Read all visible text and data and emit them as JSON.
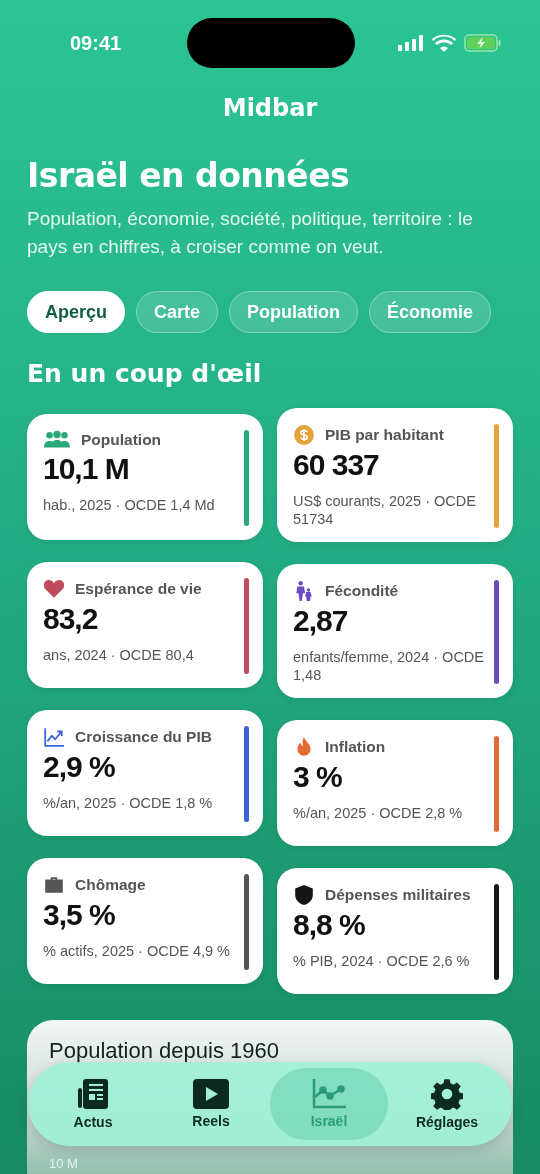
{
  "status_bar": {
    "time": "09:41"
  },
  "app_title": "Midbar",
  "header": {
    "title": "Israël en données",
    "subtitle": "Population, économie, société, politique, territoire : le pays en chiffres, à croiser comme on veut."
  },
  "tabs": [
    {
      "label": "Aperçu",
      "selected": true
    },
    {
      "label": "Carte",
      "selected": false
    },
    {
      "label": "Population",
      "selected": false
    },
    {
      "label": "Économie",
      "selected": false
    }
  ],
  "section_title": "En un coup d'œil",
  "cards": [
    {
      "label": "Population",
      "value": "10,1 M",
      "note": "hab., 2025 · OCDE 1,4 Md",
      "color": "#2aa97a"
    },
    {
      "label": "PIB par habitant",
      "value": "60 337",
      "note": "US$ courants, 2025 · OCDE 51734",
      "color": "#e3a33a"
    },
    {
      "label": "Espérance de vie",
      "value": "83,2",
      "note": "ans, 2024 · OCDE 80,4",
      "color": "#c04a5e"
    },
    {
      "label": "Fécondité",
      "value": "2,87",
      "note": "enfants/femme, 2024 · OCDE 1,48",
      "color": "#6a4bc0"
    },
    {
      "label": "Croissance du PIB",
      "value": "2,9 %",
      "note": "%/an, 2025 · OCDE 1,8 %",
      "color": "#3b63d6"
    },
    {
      "label": "Inflation",
      "value": "3 %",
      "note": "%/an, 2025 · OCDE 2,8 %",
      "color": "#e26a35"
    },
    {
      "label": "Chômage",
      "value": "3,5 %",
      "note": "% actifs, 2025 · OCDE 4,9 %",
      "color": "#555555"
    },
    {
      "label": "Dépenses militaires",
      "value": "8,8 %",
      "note": "% PIB, 2024 · OCDE 2,6 %",
      "color": "#151515"
    }
  ],
  "chart_card": {
    "title": "Population depuis 1960",
    "tick_label": "10 M"
  },
  "tab_bar": [
    {
      "label": "Actus",
      "selected": false
    },
    {
      "label": "Reels",
      "selected": false
    },
    {
      "label": "Israël",
      "selected": true
    },
    {
      "label": "Réglages",
      "selected": false
    }
  ]
}
